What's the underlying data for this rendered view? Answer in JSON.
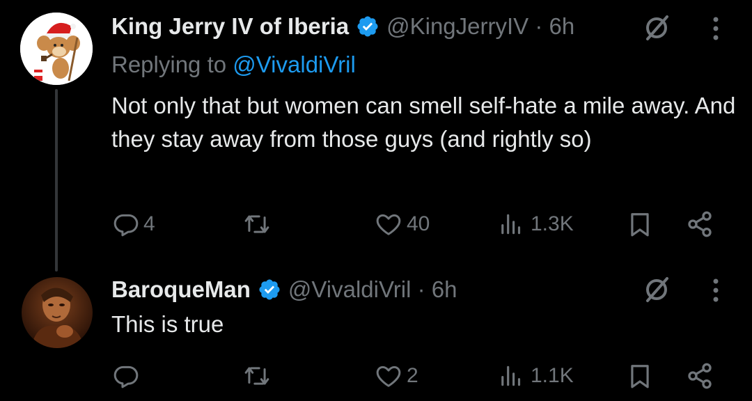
{
  "tweets": [
    {
      "author_name": "King Jerry IV of Iberia",
      "handle": "@KingJerryIV",
      "separator": " · ",
      "time": "6h",
      "replying_prefix": "Replying to ",
      "replying_to": "@VivaldiVril",
      "text": "Not only that but women can smell self-hate a mile away. And they stay away from those guys (and rightly so)",
      "actions": {
        "replies": "4",
        "reposts": "",
        "likes": "40",
        "views": "1.3K"
      }
    },
    {
      "author_name": "BaroqueMan",
      "handle": "@VivaldiVril",
      "separator": " · ",
      "time": "6h",
      "text": "This is true",
      "actions": {
        "replies": "",
        "reposts": "",
        "likes": "2",
        "views": "1.1K"
      }
    }
  ],
  "colors": {
    "background": "#000000",
    "text": "#e7e9ea",
    "secondary": "#71767b",
    "link": "#1d9bf0",
    "verified": "#1d9bf0"
  },
  "icons": [
    "verified-badge-icon",
    "grok-icon",
    "more-icon",
    "reply-icon",
    "repost-icon",
    "like-icon",
    "views-icon",
    "bookmark-icon",
    "share-icon"
  ]
}
